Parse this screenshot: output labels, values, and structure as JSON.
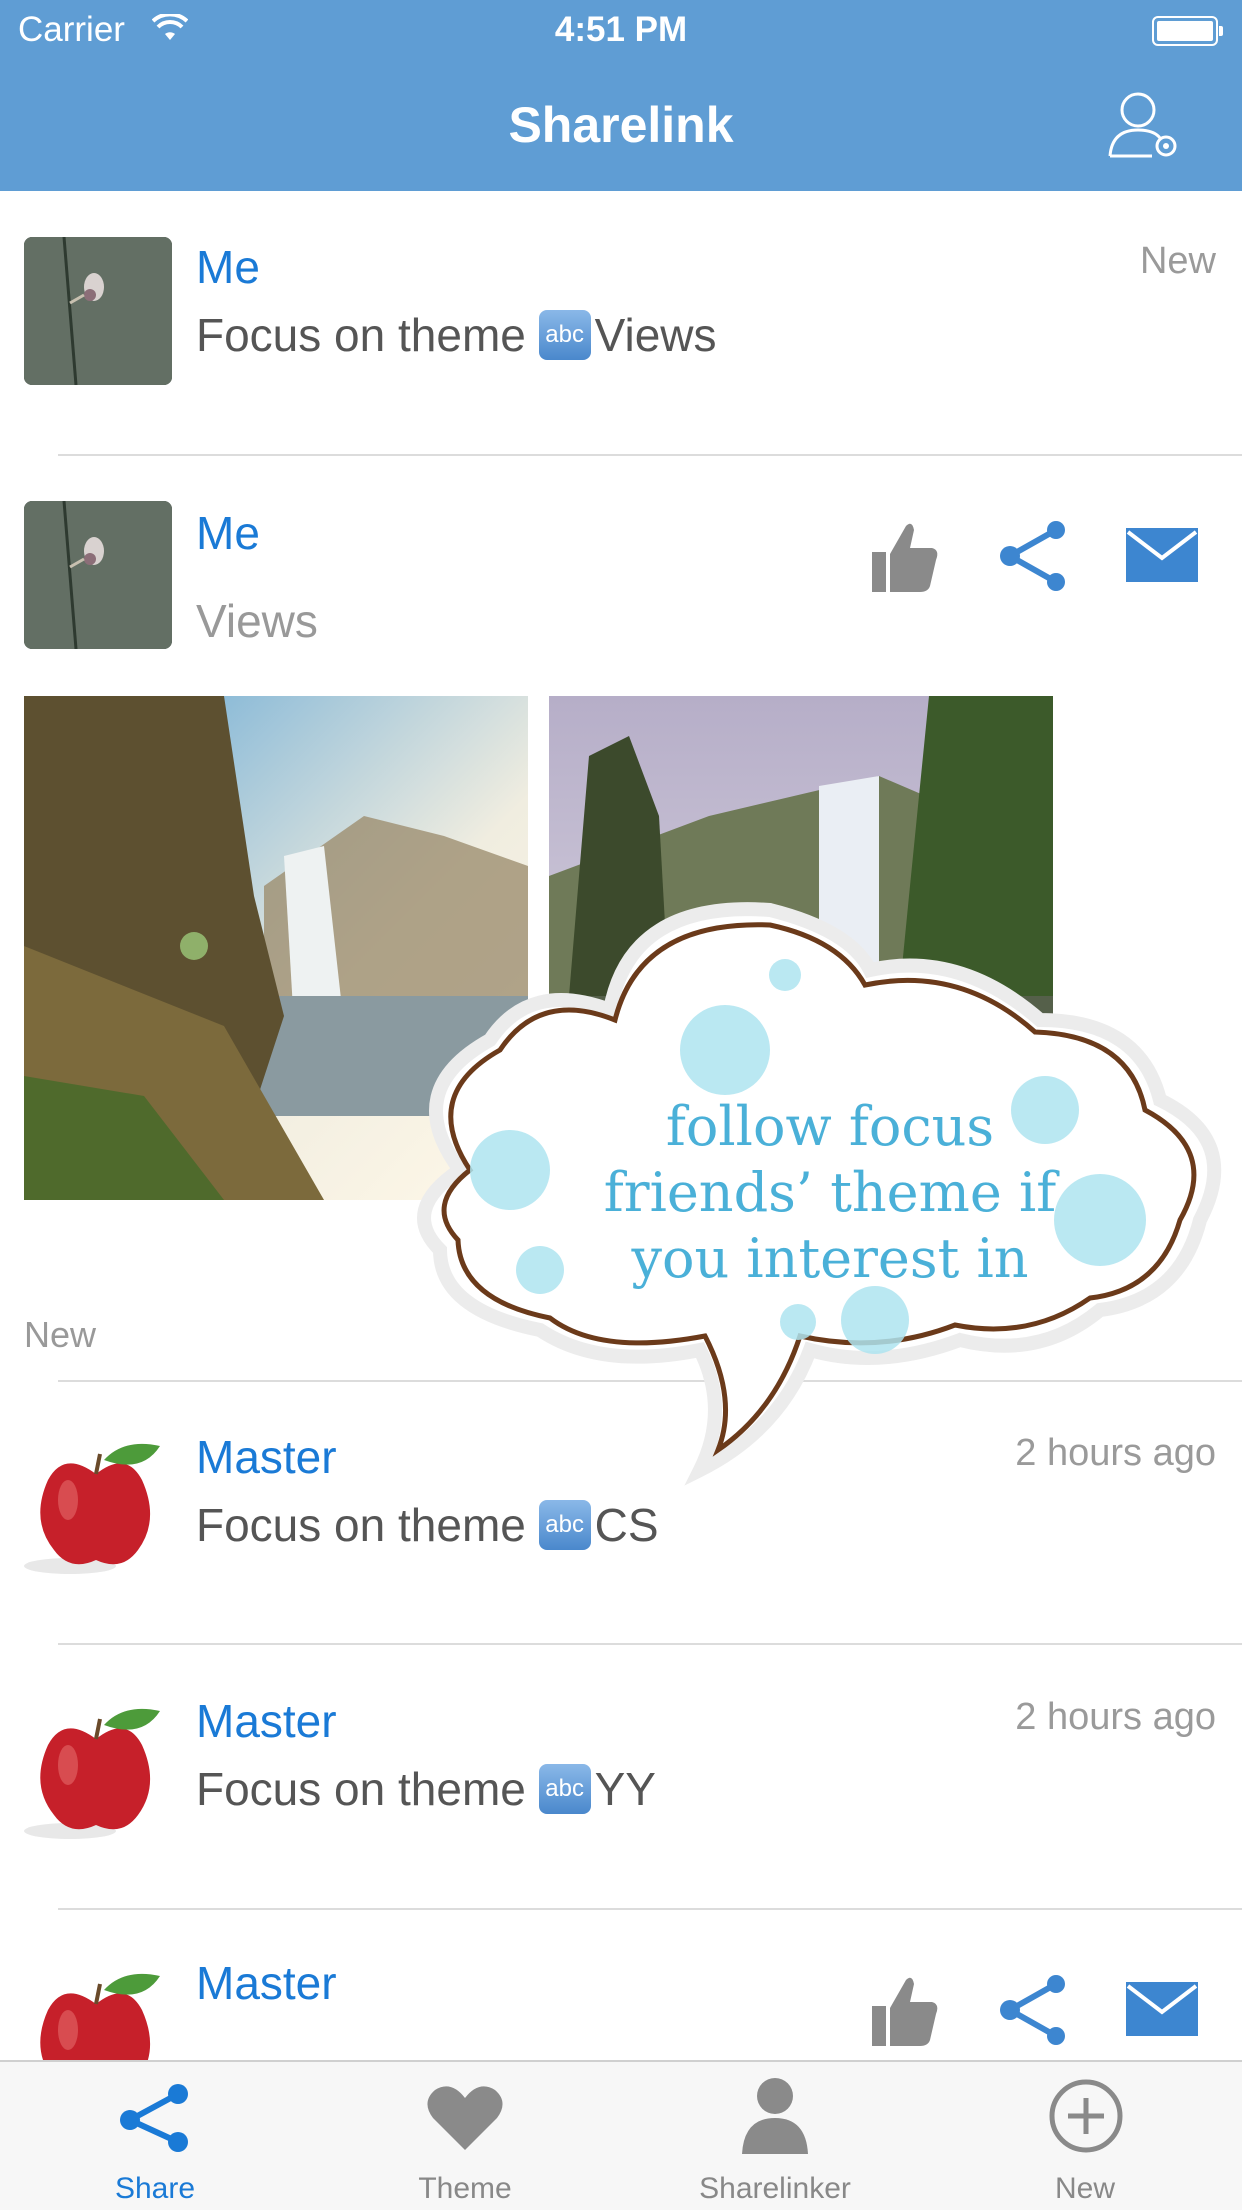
{
  "status_bar": {
    "carrier": "Carrier",
    "time": "4:51 PM"
  },
  "nav": {
    "title": "Sharelink",
    "settings_icon": "user-gear-icon"
  },
  "feed": [
    {
      "name": "Me",
      "text_prefix": "Focus on theme",
      "text_suffix": "Views",
      "time": "New",
      "avatar": "snail-thumbnail"
    },
    {
      "name": "Me",
      "subtitle": "Views",
      "actions": [
        "thumbs-up-icon",
        "share-icon",
        "mail-icon"
      ],
      "images": [
        "waterfall-photo-1",
        "waterfall-photo-2"
      ]
    },
    {
      "section_label": "New"
    },
    {
      "name": "Master",
      "text_prefix": "Focus on theme",
      "text_suffix": "CS",
      "time": "2 hours ago",
      "avatar": "apple-thumbnail"
    },
    {
      "name": "Master",
      "text_prefix": "Focus on theme",
      "text_suffix": "YY",
      "time": "2 hours ago",
      "avatar": "apple-thumbnail"
    },
    {
      "name": "Master",
      "actions": [
        "thumbs-up-icon",
        "share-icon",
        "mail-icon"
      ],
      "avatar": "apple-thumbnail"
    }
  ],
  "abc_badge": "abc",
  "tooltip": {
    "line1": "follow focus",
    "line2": "friends’ theme if",
    "line3": "you interest in"
  },
  "tabs": [
    {
      "label": "Share",
      "icon": "share-icon",
      "active": true
    },
    {
      "label": "Theme",
      "icon": "heart-icon",
      "active": false
    },
    {
      "label": "Sharelinker",
      "icon": "person-icon",
      "active": false
    },
    {
      "label": "New",
      "icon": "plus-circle-icon",
      "active": false
    }
  ],
  "colors": {
    "nav_bg": "#5f9dd4",
    "accent": "#1a7ad6",
    "icon_gray": "#8a8a8a",
    "mail_blue": "#3d86d0"
  }
}
